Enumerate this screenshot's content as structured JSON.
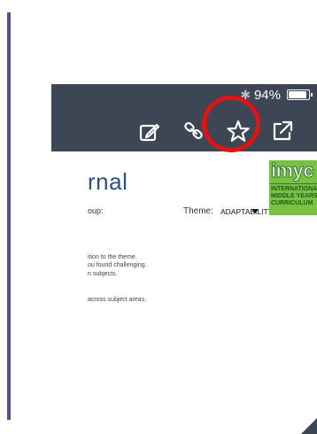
{
  "status_bar": {
    "battery_text": "94%",
    "battery_level": 0.94
  },
  "toolbar": {
    "edit_icon": "edit-icon",
    "link_icon": "link-icon",
    "star_icon": "star-icon",
    "share_icon": "share-external-icon"
  },
  "document": {
    "title_fragment": "rnal",
    "group_label": "oup:",
    "theme_label": "Theme:",
    "theme_value": "ADAPTABILITY",
    "body_lines": [
      "ition to the theme.",
      "ou found challenging.",
      "n subjects.",
      "across subject areas."
    ]
  },
  "logo": {
    "word": "imyc",
    "line1": "INTERNATIONAL",
    "line2": "MIDDLE YEARS",
    "line3": "CURRICULUM"
  },
  "colors": {
    "toolbar_bg": "#3d4654",
    "highlight_ring": "#e11414",
    "title_blue": "#2d4e86",
    "logo_green": "#7ac043",
    "left_rule": "#5b4a8c"
  }
}
